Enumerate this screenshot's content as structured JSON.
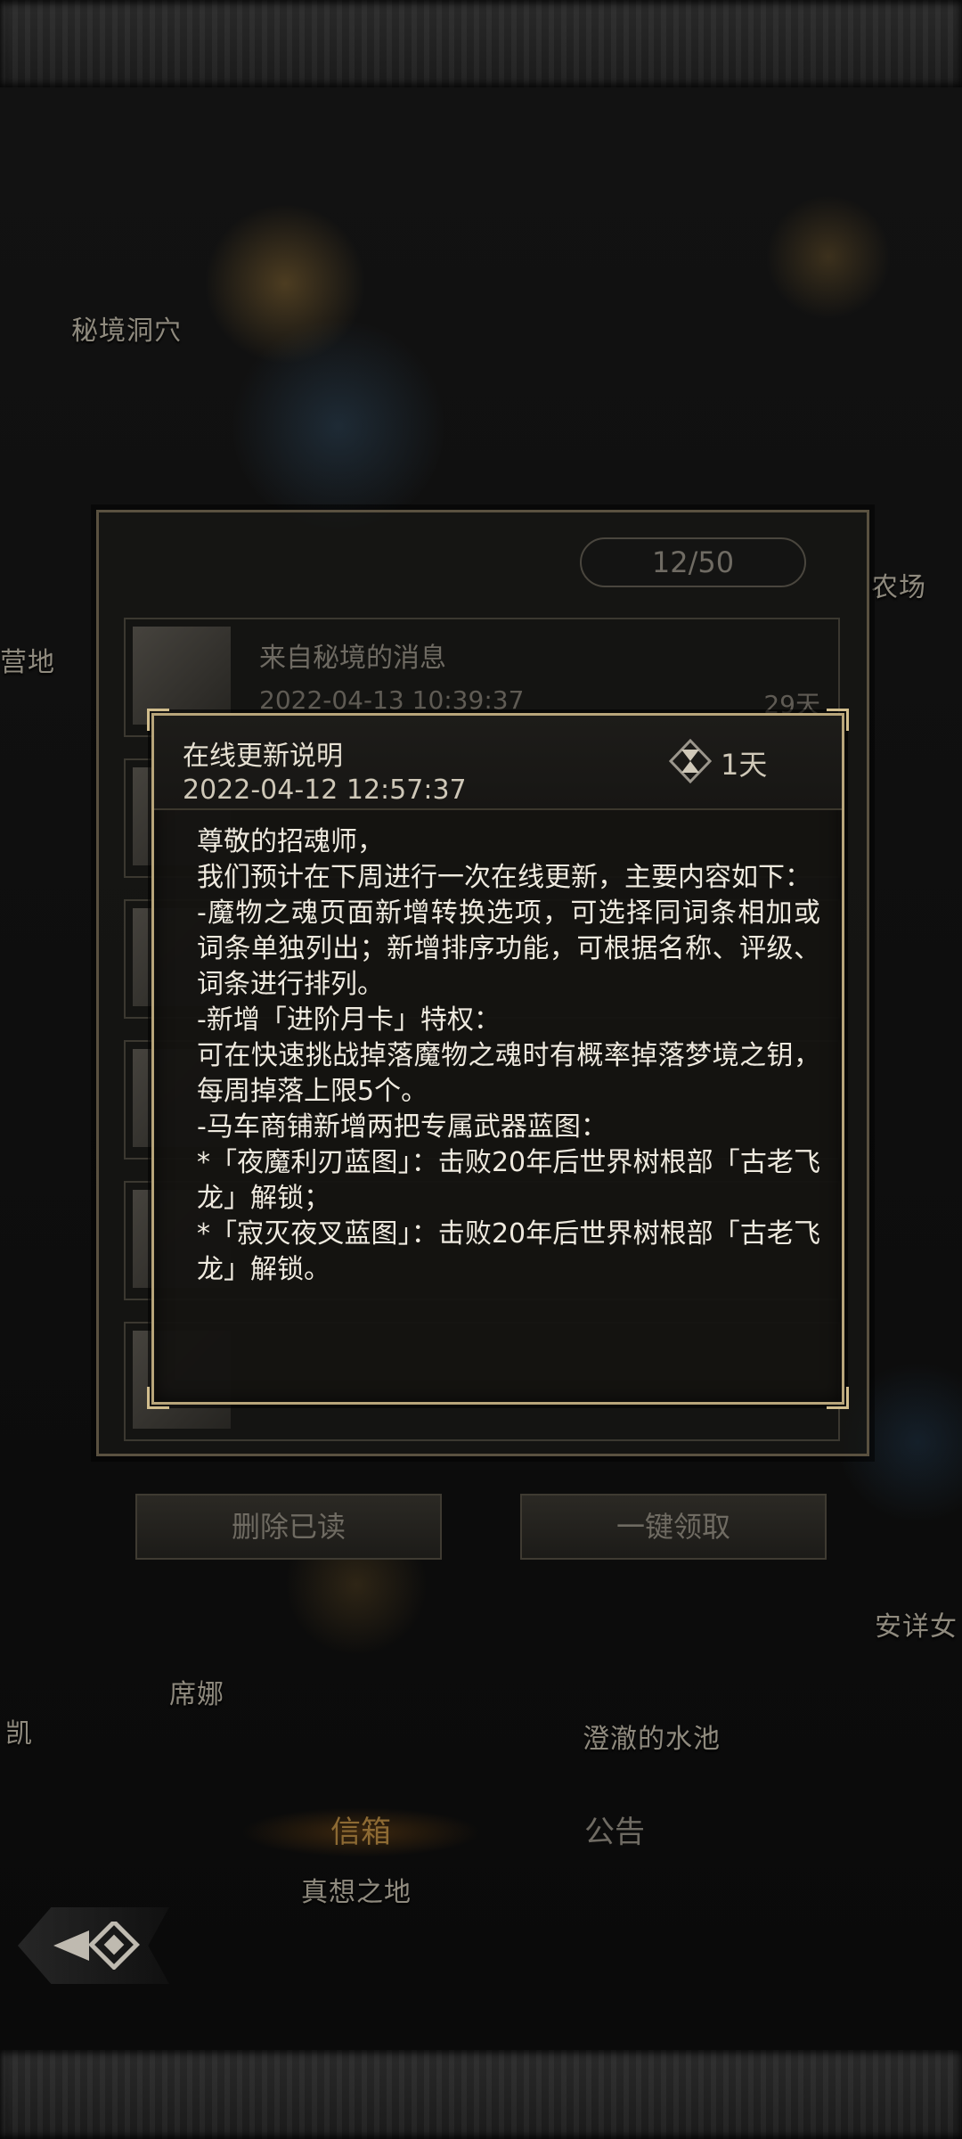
{
  "background_labels": {
    "secret_cave": "秘境洞穴",
    "farm": "农场",
    "camp": "营地",
    "sina": "席娜",
    "kai": "凯",
    "clear_pool": "澄澈的水池",
    "peaceful": "安详女",
    "dreamland": "真想之地"
  },
  "mailbox": {
    "counter": "12/50",
    "mail_item": {
      "title": "来自秘境的消息",
      "date": "2022-04-13 10:39:37",
      "days": "29天"
    },
    "delete_read_button": "删除已读",
    "claim_all_button": "一键领取"
  },
  "tabs": {
    "mailbox": "信箱",
    "notice": "公告"
  },
  "dialog": {
    "title": "在线更新说明",
    "date": "2022-04-12 12:57:37",
    "days_left": "1天",
    "body": [
      "尊敬的招魂师，",
      "我们预计在下周进行一次在线更新，主要内容如下：",
      "-魔物之魂页面新增转换选项，可选择同词条相加或词条单独列出；新增排序功能，可根据名称、评级、词条进行排列。",
      "-新增「进阶月卡」特权：",
      "可在快速挑战掉落魔物之魂时有概率掉落梦境之钥，每周掉落上限5个。",
      "-马车商铺新增两把专属武器蓝图：",
      "*「夜魔利刃蓝图」：击败20年后世界树根部「古老飞龙」解锁；",
      "*「寂灭夜叉蓝图」：击败20年后世界树根部「古老飞龙」解锁。"
    ]
  },
  "colors": {
    "gold_border": "#b8a57a",
    "dialog_bg": "#141311",
    "tab_active": "#8d6a33"
  },
  "icons": {
    "hourglass": "hourglass-icon",
    "back": "back-arrow-icon",
    "mail_thumb": "letter-icon"
  }
}
